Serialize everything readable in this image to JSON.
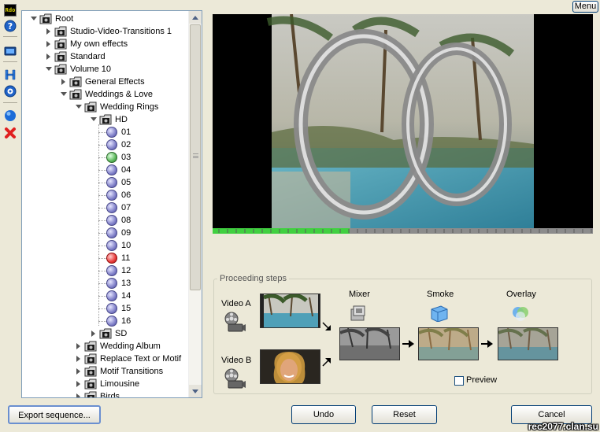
{
  "menu_label": "Menu",
  "toolbar": {
    "badge_text": "Rdo",
    "items": [
      "help-icon",
      "monitor-icon",
      "logo-icon",
      "settings-icon",
      "sphere-icon",
      "delete-icon"
    ]
  },
  "tree": {
    "items": [
      {
        "label": "Root",
        "level": 0,
        "type": "folder",
        "state": "expanded"
      },
      {
        "label": "Studio-Video-Transitions 1",
        "level": 1,
        "type": "folder",
        "state": "collapsed"
      },
      {
        "label": "My own effects",
        "level": 1,
        "type": "folder",
        "state": "collapsed"
      },
      {
        "label": "Standard",
        "level": 1,
        "type": "folder",
        "state": "collapsed"
      },
      {
        "label": "Volume 10",
        "level": 1,
        "type": "folder",
        "state": "expanded"
      },
      {
        "label": "General Effects",
        "level": 2,
        "type": "folder",
        "state": "collapsed"
      },
      {
        "label": "Weddings & Love",
        "level": 2,
        "type": "folder",
        "state": "expanded"
      },
      {
        "label": "Wedding Rings",
        "level": 3,
        "type": "folder",
        "state": "expanded"
      },
      {
        "label": "HD",
        "level": 4,
        "type": "folder",
        "state": "expanded"
      },
      {
        "label": "01",
        "level": 5,
        "type": "item",
        "status": "normal"
      },
      {
        "label": "02",
        "level": 5,
        "type": "item",
        "status": "normal"
      },
      {
        "label": "03",
        "level": 5,
        "type": "item",
        "status": "selected"
      },
      {
        "label": "04",
        "level": 5,
        "type": "item",
        "status": "normal"
      },
      {
        "label": "05",
        "level": 5,
        "type": "item",
        "status": "normal"
      },
      {
        "label": "06",
        "level": 5,
        "type": "item",
        "status": "normal"
      },
      {
        "label": "07",
        "level": 5,
        "type": "item",
        "status": "normal"
      },
      {
        "label": "08",
        "level": 5,
        "type": "item",
        "status": "normal"
      },
      {
        "label": "09",
        "level": 5,
        "type": "item",
        "status": "normal"
      },
      {
        "label": "10",
        "level": 5,
        "type": "item",
        "status": "normal"
      },
      {
        "label": "11",
        "level": 5,
        "type": "item",
        "status": "error"
      },
      {
        "label": "12",
        "level": 5,
        "type": "item",
        "status": "normal"
      },
      {
        "label": "13",
        "level": 5,
        "type": "item",
        "status": "normal"
      },
      {
        "label": "14",
        "level": 5,
        "type": "item",
        "status": "normal"
      },
      {
        "label": "15",
        "level": 5,
        "type": "item",
        "status": "normal"
      },
      {
        "label": "16",
        "level": 5,
        "type": "item",
        "status": "normal"
      },
      {
        "label": "SD",
        "level": 4,
        "type": "folder",
        "state": "collapsed"
      },
      {
        "label": "Wedding Album",
        "level": 3,
        "type": "folder",
        "state": "collapsed"
      },
      {
        "label": "Replace Text or Motif",
        "level": 3,
        "type": "folder",
        "state": "collapsed"
      },
      {
        "label": "Motif Transitions",
        "level": 3,
        "type": "folder",
        "state": "collapsed"
      },
      {
        "label": "Limousine",
        "level": 3,
        "type": "folder",
        "state": "collapsed"
      },
      {
        "label": "Birds",
        "level": 3,
        "type": "folder",
        "state": "collapsed"
      }
    ]
  },
  "playback_progress": 0.36,
  "proceeding": {
    "legend": "Proceeding steps",
    "video_a": "Video A",
    "video_b": "Video B",
    "mixer": "Mixer",
    "smoke": "Smoke",
    "overlay": "Overlay",
    "preview_label": "Preview",
    "preview_checked": false
  },
  "buttons": {
    "export": "Export sequence...",
    "undo": "Undo",
    "reset": "Reset",
    "cancel": "Cancel"
  },
  "watermark": "rec2077.clan.su",
  "colors": {
    "progress": "#40d040",
    "dialog_bg": "#ece9d8",
    "tree_border": "#7f9db9",
    "button_border": "#003c74"
  }
}
